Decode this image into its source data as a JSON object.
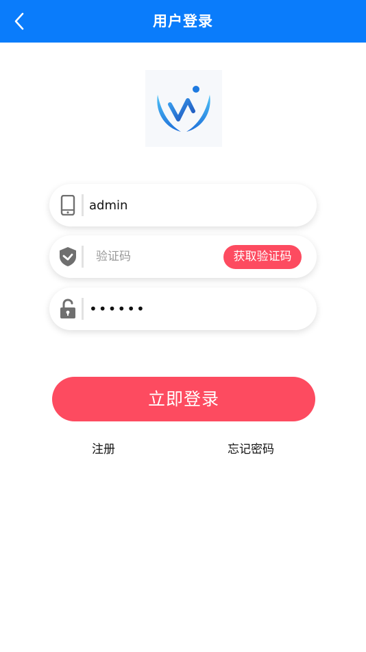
{
  "header": {
    "title": "用户登录",
    "back_icon": "chevron-left-icon"
  },
  "logo": {
    "icon": "brand-logo-icon"
  },
  "username": {
    "icon": "phone-icon",
    "value": "admin"
  },
  "code": {
    "icon": "shield-check-icon",
    "placeholder": "验证码",
    "button_label": "获取验证码"
  },
  "password": {
    "icon": "unlock-icon",
    "value": "123456"
  },
  "actions": {
    "login_label": "立即登录",
    "register_label": "注册",
    "forgot_label": "忘记密码"
  },
  "colors": {
    "header": "#0a7cfb",
    "accent": "#fd4b60",
    "icon_gray": "#6f6f6f"
  }
}
